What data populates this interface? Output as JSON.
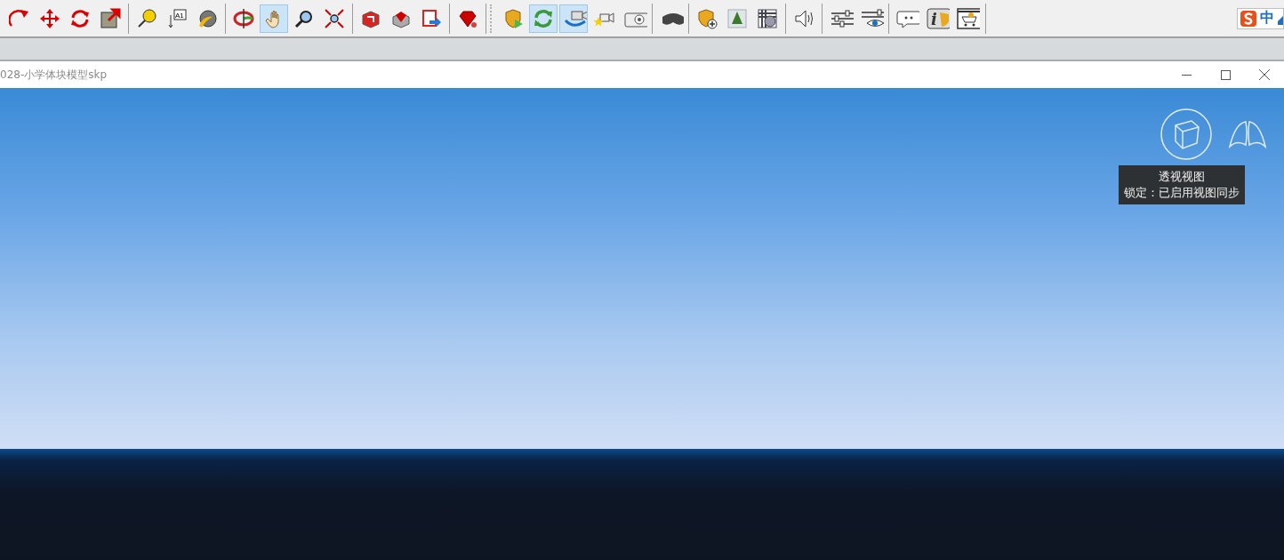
{
  "toolbar": {
    "groups": [
      {
        "items": [
          {
            "kind": "arc-arrow",
            "selected": false
          },
          {
            "kind": "move",
            "selected": false
          },
          {
            "kind": "rotate",
            "selected": false
          },
          {
            "kind": "scale",
            "selected": false
          }
        ]
      },
      {
        "items": [
          {
            "kind": "tape",
            "selected": false
          },
          {
            "kind": "text-label",
            "selected": false,
            "text": "A1"
          },
          {
            "kind": "paint-bucket",
            "selected": false
          }
        ]
      },
      {
        "items": [
          {
            "kind": "orbit",
            "selected": false
          },
          {
            "kind": "hand",
            "selected": true
          },
          {
            "kind": "magnifier",
            "selected": false
          },
          {
            "kind": "zoom-extents",
            "selected": false
          }
        ]
      },
      {
        "items": [
          {
            "kind": "box",
            "selected": false
          },
          {
            "kind": "gem-box",
            "selected": false
          },
          {
            "kind": "export",
            "selected": false
          }
        ]
      },
      {
        "items": [
          {
            "kind": "gem",
            "selected": false
          }
        ]
      },
      {
        "grip": true,
        "items": [
          {
            "kind": "shield-play",
            "selected": false
          },
          {
            "kind": "refresh",
            "selected": true
          },
          {
            "kind": "camera-arrow",
            "selected": true
          },
          {
            "kind": "camera-star",
            "selected": false
          },
          {
            "kind": "camera",
            "selected": false
          }
        ]
      },
      {
        "items": [
          {
            "kind": "vr-headset",
            "selected": false
          }
        ]
      },
      {
        "items": [
          {
            "kind": "shield-plus",
            "selected": false
          },
          {
            "kind": "tree-cube",
            "selected": false
          },
          {
            "kind": "gear-grid",
            "selected": false
          }
        ]
      },
      {
        "items": [
          {
            "kind": "speaker",
            "selected": false
          }
        ]
      },
      {
        "items": [
          {
            "kind": "sliders",
            "selected": false
          },
          {
            "kind": "sliders-eye",
            "selected": false
          }
        ]
      },
      {
        "items": [
          {
            "kind": "speech-bubble",
            "selected": false
          },
          {
            "kind": "info",
            "selected": false,
            "text": "i"
          },
          {
            "kind": "cart",
            "selected": false
          }
        ]
      }
    ]
  },
  "ime": {
    "label": "中"
  },
  "window": {
    "title": "028-小学体块模型skp"
  },
  "viewport": {
    "tooltip": {
      "lines": [
        "透视视图",
        "锁定：已启用视图同步"
      ]
    }
  }
}
